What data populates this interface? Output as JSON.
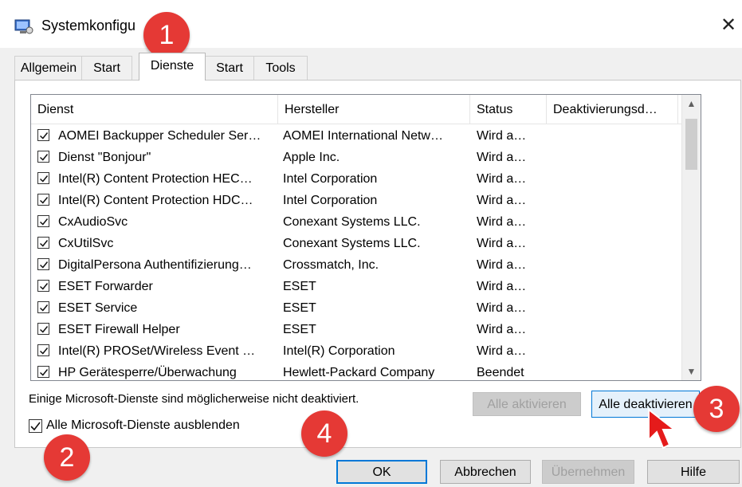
{
  "window": {
    "title": "Systemkonfigu",
    "close_glyph": "✕"
  },
  "tabs": [
    {
      "label": "Allgemein"
    },
    {
      "label": "Start"
    },
    {
      "label": "Dienste"
    },
    {
      "label": "Start"
    },
    {
      "label": "Tools"
    }
  ],
  "table": {
    "columns": [
      "Dienst",
      "Hersteller",
      "Status",
      "Deaktivierungsd…"
    ],
    "rows": [
      {
        "dienst": "AOMEI Backupper Scheduler Ser…",
        "hersteller": "AOMEI International Netw…",
        "status": "Wird a…",
        "checked": true
      },
      {
        "dienst": "Dienst \"Bonjour\"",
        "hersteller": "Apple Inc.",
        "status": "Wird a…",
        "checked": true
      },
      {
        "dienst": "Intel(R) Content Protection HEC…",
        "hersteller": "Intel Corporation",
        "status": "Wird a…",
        "checked": true
      },
      {
        "dienst": "Intel(R) Content Protection HDC…",
        "hersteller": "Intel Corporation",
        "status": "Wird a…",
        "checked": true
      },
      {
        "dienst": "CxAudioSvc",
        "hersteller": "Conexant Systems LLC.",
        "status": "Wird a…",
        "checked": true
      },
      {
        "dienst": "CxUtilSvc",
        "hersteller": "Conexant Systems LLC.",
        "status": "Wird a…",
        "checked": true
      },
      {
        "dienst": "DigitalPersona Authentifizierung…",
        "hersteller": "Crossmatch, Inc.",
        "status": "Wird a…",
        "checked": true
      },
      {
        "dienst": "ESET Forwarder",
        "hersteller": "ESET",
        "status": "Wird a…",
        "checked": true
      },
      {
        "dienst": "ESET Service",
        "hersteller": "ESET",
        "status": "Wird a…",
        "checked": true
      },
      {
        "dienst": "ESET Firewall Helper",
        "hersteller": "ESET",
        "status": "Wird a…",
        "checked": true
      },
      {
        "dienst": "Intel(R) PROSet/Wireless Event …",
        "hersteller": "Intel(R) Corporation",
        "status": "Wird a…",
        "checked": true
      },
      {
        "dienst": "HP Gerätesperre/Überwachung",
        "hersteller": "Hewlett-Packard Company",
        "status": "Beendet",
        "checked": true
      }
    ]
  },
  "note": "Einige Microsoft-Dienste sind möglicherweise nicht deaktiviert.",
  "buttons": {
    "enable_all": "Alle aktivieren",
    "disable_all": "Alle deaktivieren",
    "hide_ms_label": "Alle Microsoft-Dienste ausblenden",
    "ok": "OK",
    "cancel": "Abbrechen",
    "apply": "Übernehmen",
    "help": "Hilfe"
  },
  "hide_ms_checked": true,
  "badges": [
    "1",
    "2",
    "3",
    "4"
  ],
  "colors": {
    "badge": "#e53935",
    "focus": "#0078d7"
  }
}
